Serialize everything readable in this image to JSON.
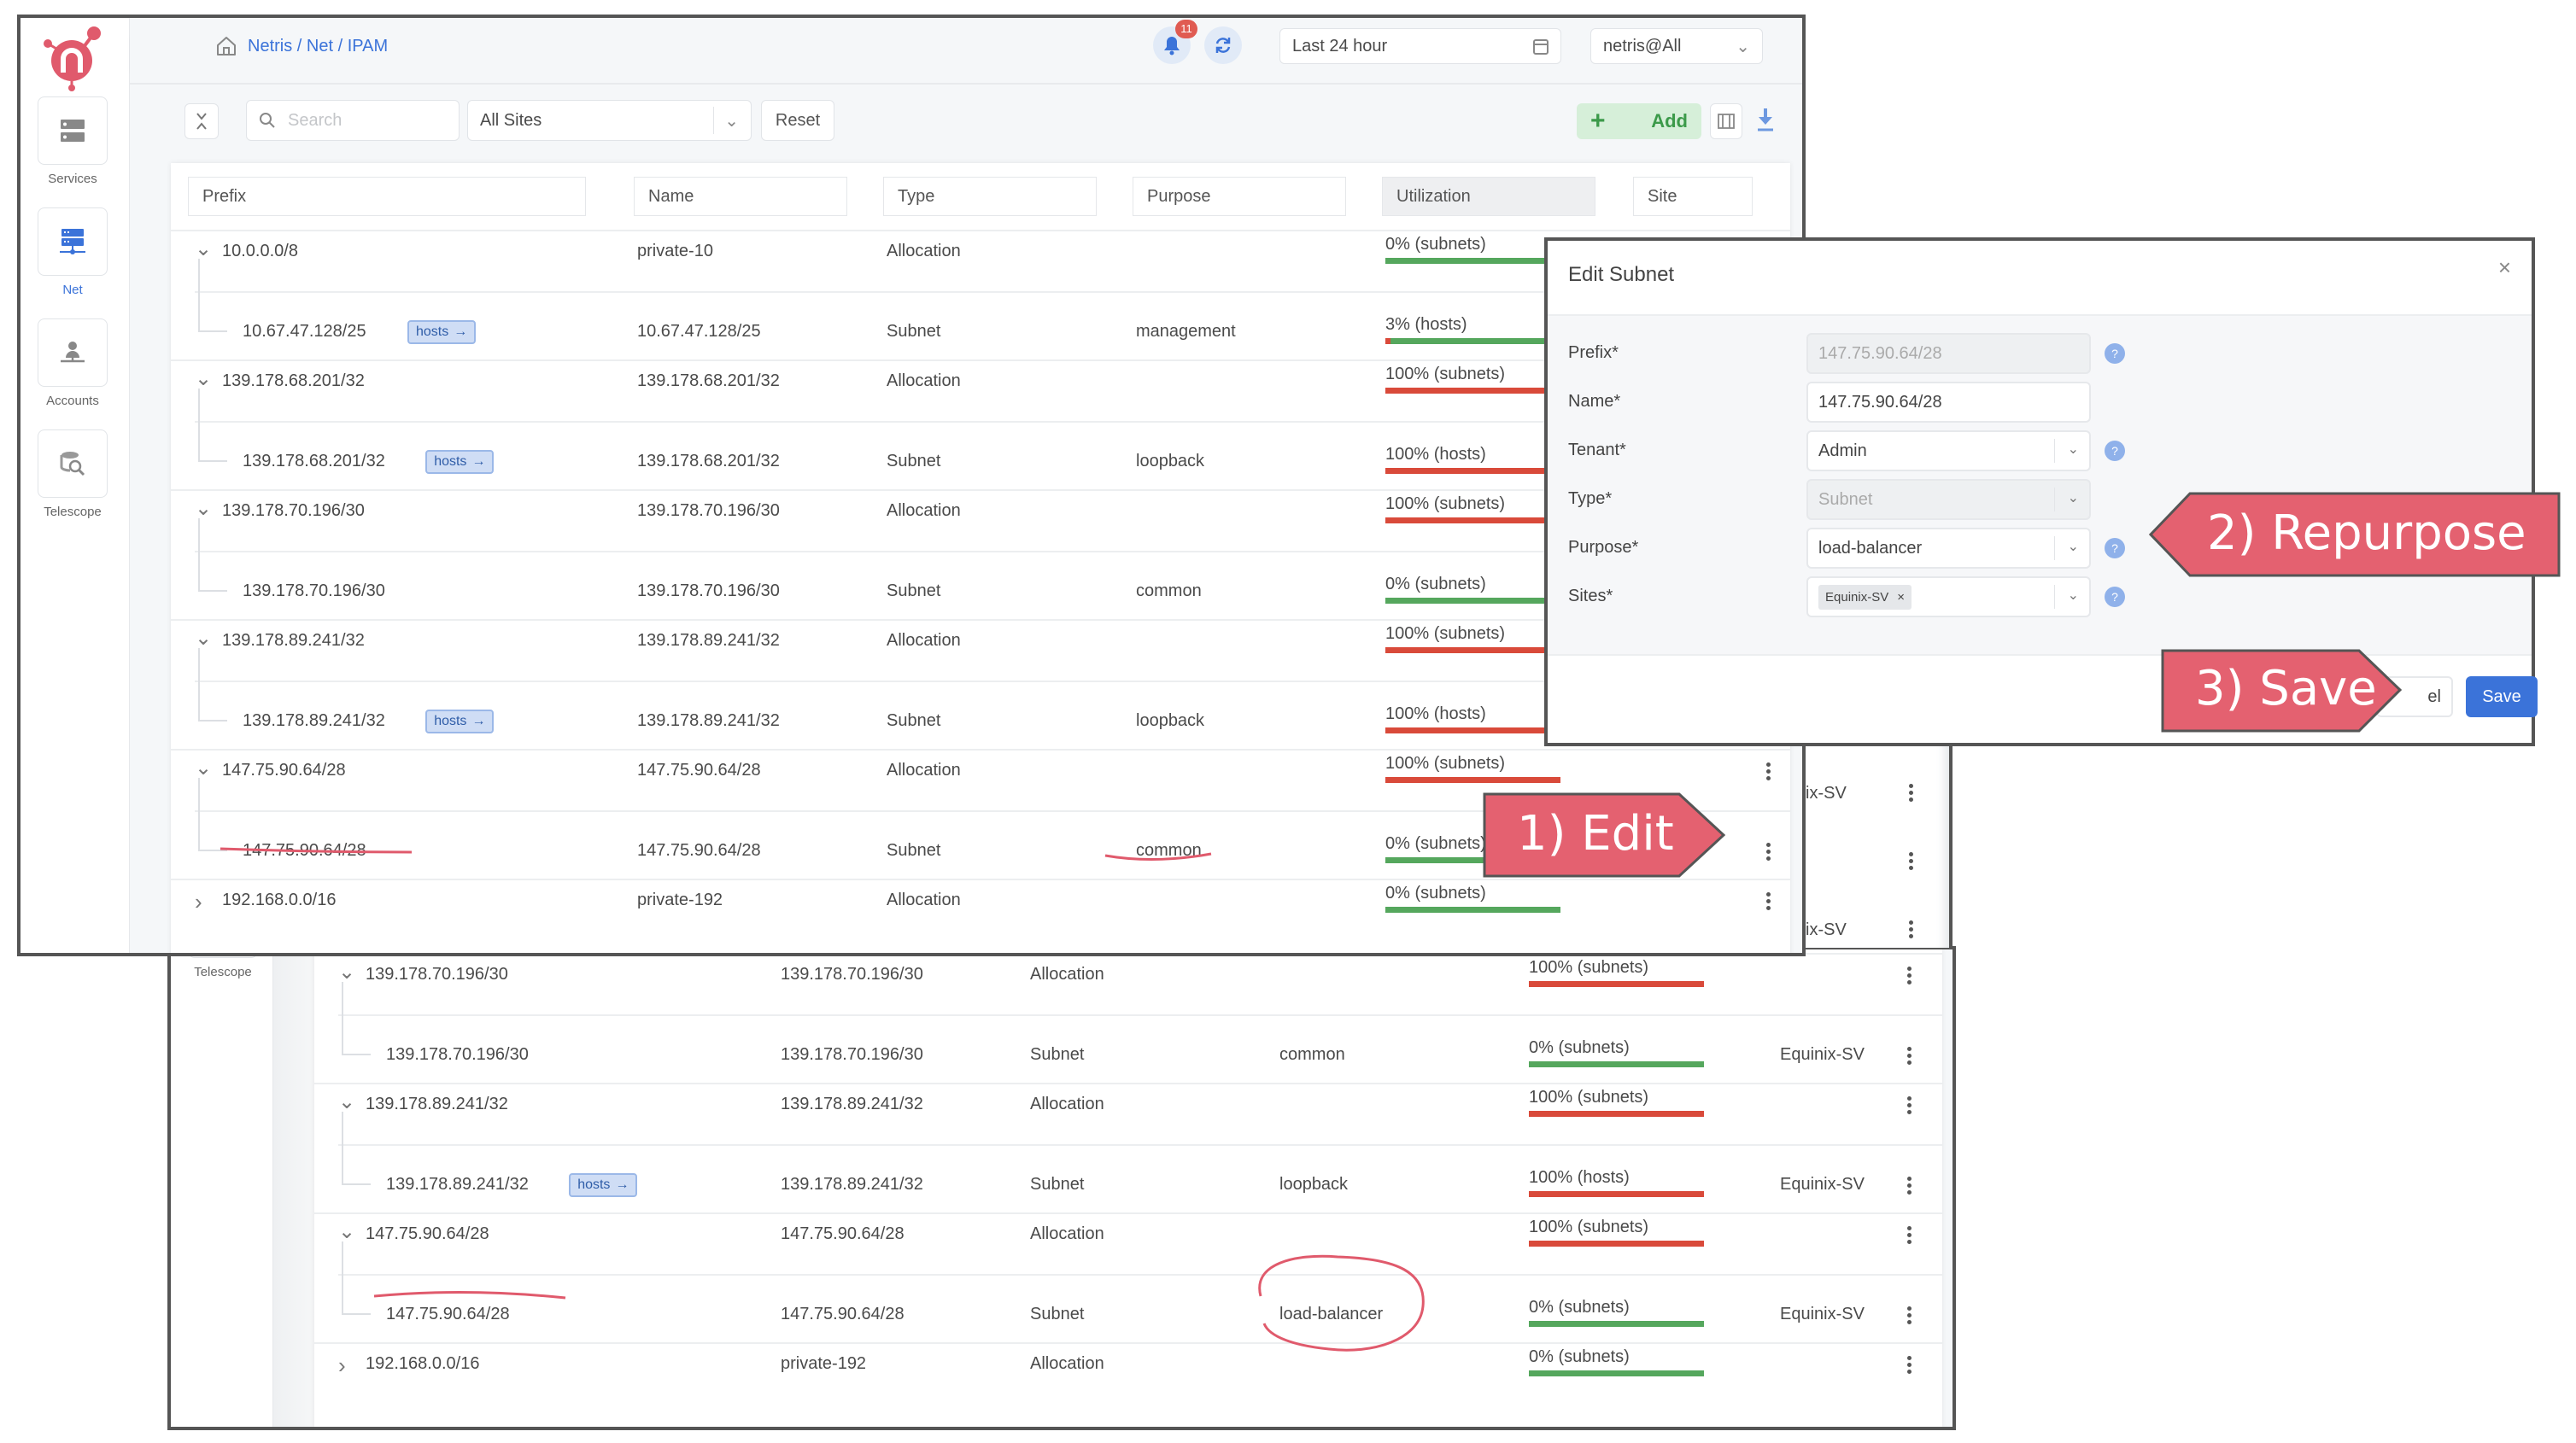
{
  "app": {
    "breadcrumb": "Netris / Net / IPAM",
    "notifications_count": "11",
    "time_range": "Last 24 hour",
    "tenant_select": "netris@All"
  },
  "sidebar": {
    "items": [
      {
        "label": "Services",
        "icon": "services-icon",
        "active": false
      },
      {
        "label": "Net",
        "icon": "network-icon",
        "active": true
      },
      {
        "label": "Accounts",
        "icon": "accounts-icon",
        "active": false
      },
      {
        "label": "Telescope",
        "icon": "telescope-icon",
        "active": false
      }
    ]
  },
  "toolbar": {
    "search_placeholder": "Search",
    "site_filter": "All Sites",
    "reset_label": "Reset",
    "add_label": "Add",
    "add_icon": "+"
  },
  "table": {
    "columns": [
      "Prefix",
      "Name",
      "Type",
      "Purpose",
      "Utilization",
      "Site"
    ],
    "hosts_label": "hosts",
    "rows_top": [
      {
        "prefix": "10.0.0.0/8",
        "name": "private-10",
        "type": "Allocation",
        "purpose": "",
        "util": "0% (subnets)",
        "util_pct": 0,
        "site": "",
        "level": 0,
        "expanded": true
      },
      {
        "prefix": "10.67.47.128/25",
        "name": "10.67.47.128/25",
        "type": "Subnet",
        "purpose": "management",
        "util": "3% (hosts)",
        "util_pct": 3,
        "site": "",
        "level": 1,
        "hosts": true
      },
      {
        "prefix": "139.178.68.201/32",
        "name": "139.178.68.201/32",
        "type": "Allocation",
        "purpose": "",
        "util": "100% (subnets)",
        "util_pct": 100,
        "site": "",
        "level": 0,
        "expanded": true
      },
      {
        "prefix": "139.178.68.201/32",
        "name": "139.178.68.201/32",
        "type": "Subnet",
        "purpose": "loopback",
        "util": "100% (hosts)",
        "util_pct": 100,
        "site": "",
        "level": 1,
        "hosts": true
      },
      {
        "prefix": "139.178.70.196/30",
        "name": "139.178.70.196/30",
        "type": "Allocation",
        "purpose": "",
        "util": "100% (subnets)",
        "util_pct": 100,
        "site": "",
        "level": 0,
        "expanded": true
      },
      {
        "prefix": "139.178.70.196/30",
        "name": "139.178.70.196/30",
        "type": "Subnet",
        "purpose": "common",
        "util": "0% (subnets)",
        "util_pct": 0,
        "site": "",
        "level": 1,
        "hosts": false
      },
      {
        "prefix": "139.178.89.241/32",
        "name": "139.178.89.241/32",
        "type": "Allocation",
        "purpose": "",
        "util": "100% (subnets)",
        "util_pct": 100,
        "site": "",
        "level": 0,
        "expanded": true
      },
      {
        "prefix": "139.178.89.241/32",
        "name": "139.178.89.241/32",
        "type": "Subnet",
        "purpose": "loopback",
        "util": "100% (hosts)",
        "util_pct": 100,
        "site": "",
        "level": 1,
        "hosts": true
      },
      {
        "prefix": "147.75.90.64/28",
        "name": "147.75.90.64/28",
        "type": "Allocation",
        "purpose": "",
        "util": "100% (subnets)",
        "util_pct": 100,
        "site": "",
        "level": 0,
        "expanded": true
      },
      {
        "prefix": "147.75.90.64/28",
        "name": "147.75.90.64/28",
        "type": "Subnet",
        "purpose": "common",
        "util": "0% (subnets)",
        "util_pct": 0,
        "site": "",
        "level": 1,
        "hosts": false
      },
      {
        "prefix": "192.168.0.0/16",
        "name": "private-192",
        "type": "Allocation",
        "purpose": "",
        "util": "0% (subnets)",
        "util_pct": 0,
        "site": "",
        "level": 0,
        "expanded": false
      }
    ],
    "rows_bottom": [
      {
        "prefix": "139.178.70.196/30",
        "name": "139.178.70.196/30",
        "type": "Allocation",
        "purpose": "",
        "util": "100% (subnets)",
        "util_pct": 100,
        "site": "",
        "level": 0,
        "expanded": true
      },
      {
        "prefix": "139.178.70.196/30",
        "name": "139.178.70.196/30",
        "type": "Subnet",
        "purpose": "common",
        "util": "0% (subnets)",
        "util_pct": 0,
        "site": "Equinix-SV",
        "level": 1,
        "hosts": false
      },
      {
        "prefix": "139.178.89.241/32",
        "name": "139.178.89.241/32",
        "type": "Allocation",
        "purpose": "",
        "util": "100% (subnets)",
        "util_pct": 100,
        "site": "",
        "level": 0,
        "expanded": true
      },
      {
        "prefix": "139.178.89.241/32",
        "name": "139.178.89.241/32",
        "type": "Subnet",
        "purpose": "loopback",
        "util": "100% (hosts)",
        "util_pct": 100,
        "site": "Equinix-SV",
        "level": 1,
        "hosts": true
      },
      {
        "prefix": "147.75.90.64/28",
        "name": "147.75.90.64/28",
        "type": "Allocation",
        "purpose": "",
        "util": "100% (subnets)",
        "util_pct": 100,
        "site": "",
        "level": 0,
        "expanded": true
      },
      {
        "prefix": "147.75.90.64/28",
        "name": "147.75.90.64/28",
        "type": "Subnet",
        "purpose": "load-balancer",
        "util": "0% (subnets)",
        "util_pct": 0,
        "site": "Equinix-SV",
        "level": 1,
        "hosts": false
      },
      {
        "prefix": "192.168.0.0/16",
        "name": "private-192",
        "type": "Allocation",
        "purpose": "",
        "util": "0% (subnets)",
        "util_pct": 0,
        "site": "",
        "level": 0,
        "expanded": false
      }
    ],
    "hidden_site_fragments": [
      "ix-SV",
      "",
      "ix-SV"
    ]
  },
  "dialog": {
    "title": "Edit Subnet",
    "fields": [
      {
        "label": "Prefix*",
        "value": "147.75.90.64/28",
        "disabled": true,
        "kind": "text",
        "help": true
      },
      {
        "label": "Name*",
        "value": "147.75.90.64/28",
        "disabled": false,
        "kind": "text",
        "help": false
      },
      {
        "label": "Tenant*",
        "value": "Admin",
        "disabled": false,
        "kind": "select",
        "help": true
      },
      {
        "label": "Type*",
        "value": "Subnet",
        "disabled": true,
        "kind": "select",
        "help": false
      },
      {
        "label": "Purpose*",
        "value": "load-balancer",
        "disabled": false,
        "kind": "select",
        "help": true
      },
      {
        "label": "Sites*",
        "value": "Equinix-SV",
        "disabled": false,
        "kind": "tags",
        "help": true
      }
    ],
    "tag_remove": "×",
    "cancel_fragment": "el",
    "save_label": "Save"
  },
  "annotations": {
    "step1": "1) Edit",
    "step2": "2) Repurpose",
    "step3": "3) Save",
    "color": "#e46170"
  },
  "colors": {
    "brand": "#e05a6c",
    "accent": "#3b73d9",
    "util_ok": "#55a75d",
    "util_full": "#d94a3a",
    "add_bg": "#d6efd9"
  }
}
